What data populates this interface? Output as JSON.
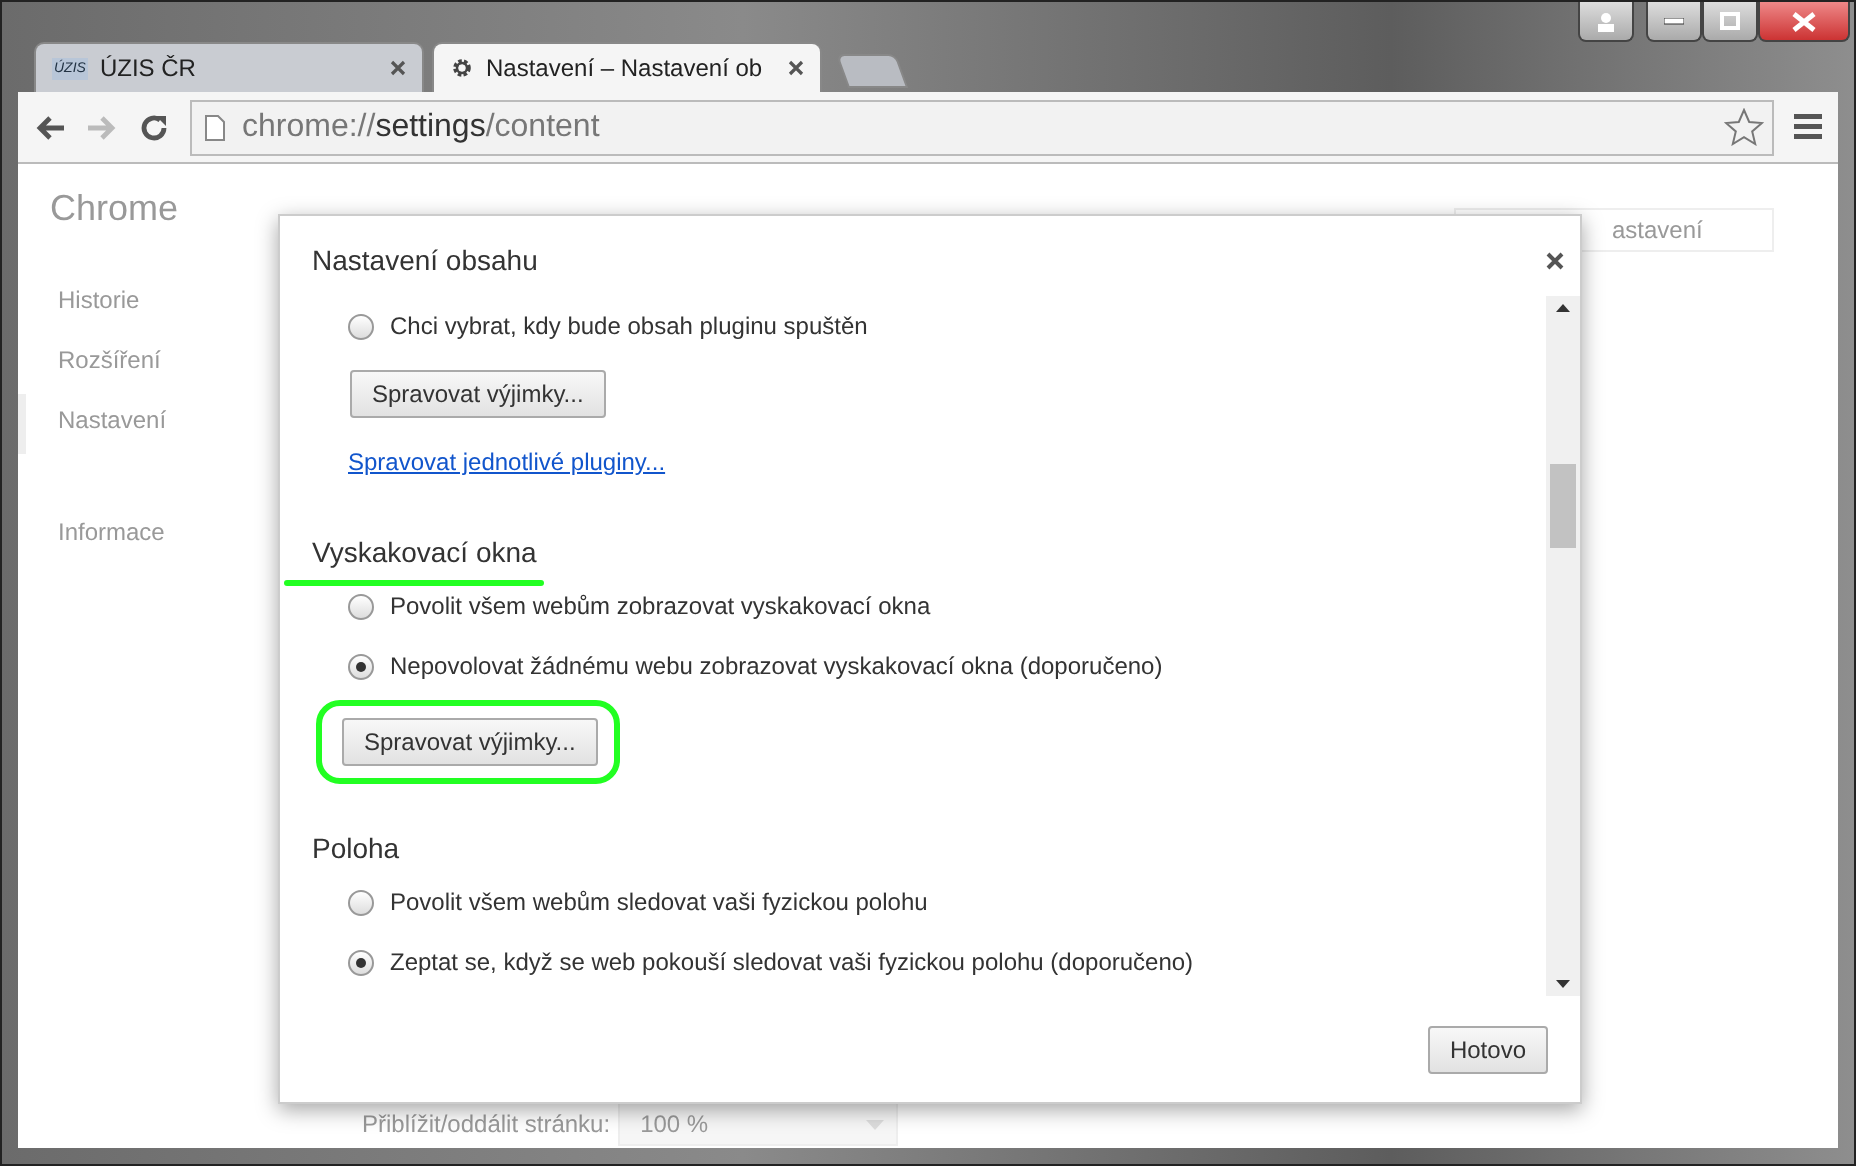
{
  "tabs": [
    {
      "logo_text": "ÚZIS",
      "title": "ÚZIS ČR",
      "selected": false
    },
    {
      "title": "Nastavení – Nastavení ob",
      "selected": true
    }
  ],
  "address_bar": {
    "scheme": "chrome://",
    "host": "settings",
    "path": "/content"
  },
  "page": {
    "brand": "Chrome",
    "sidebar": [
      {
        "label": "Historie",
        "selected": false
      },
      {
        "label": "Rozšíření",
        "selected": false
      },
      {
        "label": "Nastavení",
        "selected": true
      },
      {
        "label": "Informace",
        "selected": false
      }
    ],
    "search_value": "astavení",
    "zoom_label": "Přiblížit/oddálit stránku:",
    "zoom_value": "100 %"
  },
  "dialog": {
    "title": "Nastavení obsahu",
    "sections": [
      {
        "highlighted": false,
        "items": [
          {
            "kind": "radio",
            "label": "Chci vybrat, kdy bude obsah pluginu spuštěn",
            "selected": false
          },
          {
            "kind": "button",
            "label": "Spravovat výjimky..."
          },
          {
            "kind": "link",
            "label": "Spravovat jednotlivé pluginy..."
          }
        ]
      },
      {
        "heading": "Vyskakovací okna",
        "highlighted": true,
        "items": [
          {
            "kind": "radio",
            "label": "Povolit všem webům zobrazovat vyskakovací okna",
            "selected": false
          },
          {
            "kind": "radio",
            "label": "Nepovolovat žádnému webu zobrazovat vyskakovací okna (doporučeno)",
            "selected": true
          },
          {
            "kind": "button",
            "label": "Spravovat výjimky..."
          }
        ]
      },
      {
        "heading": "Poloha",
        "highlighted": false,
        "items": [
          {
            "kind": "radio",
            "label": "Povolit všem webům sledovat vaši fyzickou polohu",
            "selected": false
          },
          {
            "kind": "radio",
            "label": "Zeptat se, když se web pokouší sledovat vaši fyzickou polohu (doporučeno)",
            "selected": true
          }
        ]
      }
    ],
    "done_button": "Hotovo"
  }
}
